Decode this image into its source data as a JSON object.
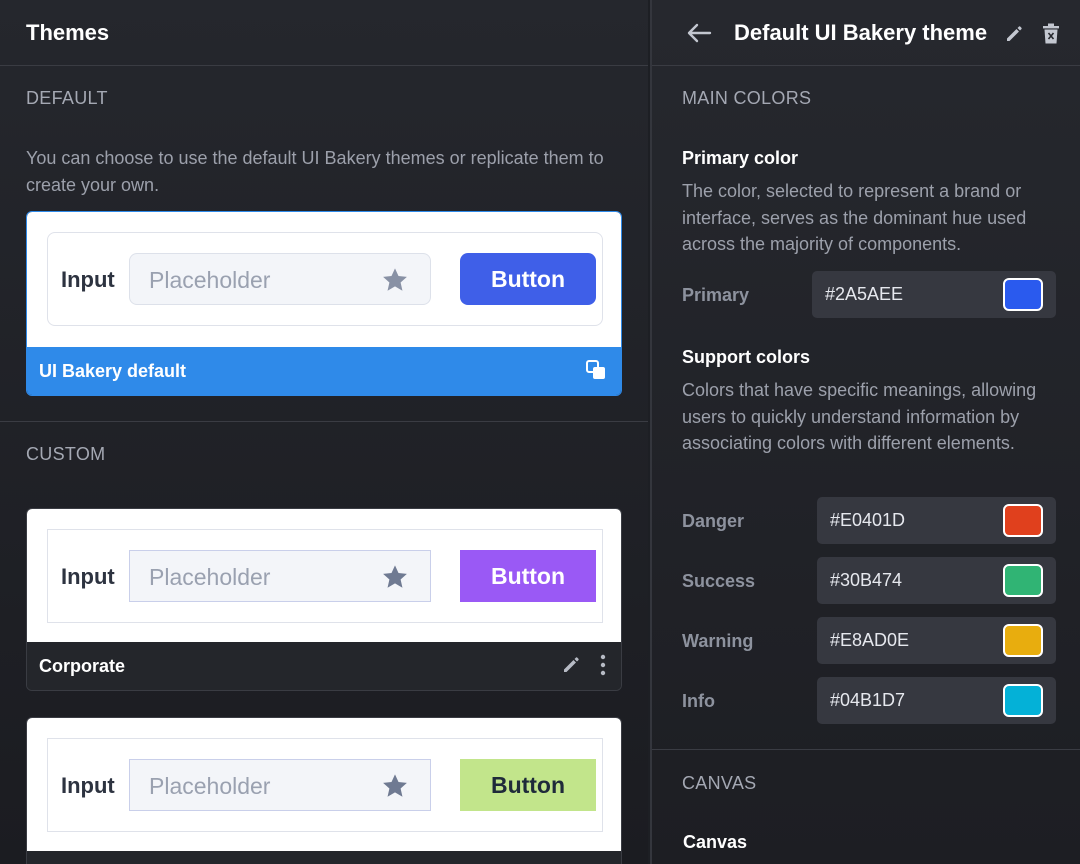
{
  "left": {
    "title": "Themes",
    "default_section": "DEFAULT",
    "default_desc": "You can choose to use the default UI Bakery themes or replicate them to create your own.",
    "custom_section": "CUSTOM",
    "themes": [
      {
        "name": "UI Bakery default",
        "input_label": "Input",
        "placeholder": "Placeholder",
        "button_label": "Button",
        "button_color": "#3f5fe8",
        "button_text_color": "#ffffff",
        "footer_color": "#2f8ae9"
      },
      {
        "name": "Corporate",
        "input_label": "Input",
        "placeholder": "Placeholder",
        "button_label": "Button",
        "button_color": "#9a59f5",
        "button_text_color": "#ffffff",
        "footer_color": "#24262b"
      },
      {
        "name": "",
        "input_label": "Input",
        "placeholder": "Placeholder",
        "button_label": "Button",
        "button_color": "#c2e58b",
        "button_text_color": "#1f2a3a",
        "footer_color": "#24262b"
      }
    ]
  },
  "right": {
    "title": "Default UI Bakery theme",
    "main_colors_section": "MAIN COLORS",
    "primary_heading": "Primary color",
    "primary_desc": "The color, selected to represent a brand or interface, serves as the dominant hue used across the majority of components.",
    "primary": {
      "label": "Primary",
      "hex": "#2A5AEE",
      "color": "#2A5AEE"
    },
    "support_heading": "Support colors",
    "support_desc": "Colors that have specific meanings, allowing users to quickly understand information by associating colors with different elements.",
    "support": [
      {
        "label": "Danger",
        "hex": "#E0401D",
        "color": "#E0401D"
      },
      {
        "label": "Success",
        "hex": "#30B474",
        "color": "#30B474"
      },
      {
        "label": "Warning",
        "hex": "#E8AD0E",
        "color": "#E8AD0E"
      },
      {
        "label": "Info",
        "hex": "#04B1D7",
        "color": "#04B1D7"
      }
    ],
    "canvas_section": "CANVAS",
    "canvas_heading": "Canvas"
  }
}
